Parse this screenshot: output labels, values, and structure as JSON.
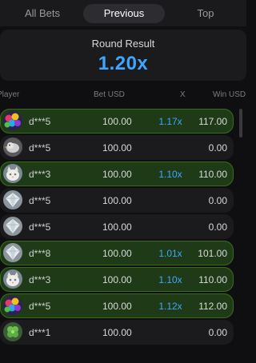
{
  "tabs": [
    {
      "label": "All Bets",
      "active": false
    },
    {
      "label": "Previous",
      "active": true
    },
    {
      "label": "Top",
      "active": false
    }
  ],
  "round": {
    "label": "Round Result",
    "value": "1.20x"
  },
  "columns": {
    "player": "Player",
    "bet": "Bet USD",
    "x": "X",
    "win": "Win USD"
  },
  "rows": [
    {
      "avatar": "balloons-avatar-icon",
      "name": "d***5",
      "bet": "100.00",
      "mult": "1.17x",
      "win": "117.00",
      "won": true
    },
    {
      "avatar": "bird-avatar-icon",
      "name": "d***5",
      "bet": "100.00",
      "mult": "",
      "win": "0.00",
      "won": false
    },
    {
      "avatar": "cat-avatar-icon",
      "name": "d***3",
      "bet": "100.00",
      "mult": "1.10x",
      "win": "110.00",
      "won": true
    },
    {
      "avatar": "diamond-avatar-icon",
      "name": "d***5",
      "bet": "100.00",
      "mult": "",
      "win": "0.00",
      "won": false
    },
    {
      "avatar": "diamond-avatar-icon",
      "name": "d***5",
      "bet": "100.00",
      "mult": "",
      "win": "0.00",
      "won": false
    },
    {
      "avatar": "diamond-avatar-icon",
      "name": "d***8",
      "bet": "100.00",
      "mult": "1.01x",
      "win": "101.00",
      "won": true
    },
    {
      "avatar": "cat-avatar-icon",
      "name": "d***3",
      "bet": "100.00",
      "mult": "1.10x",
      "win": "110.00",
      "won": true
    },
    {
      "avatar": "balloons-avatar-icon",
      "name": "d***5",
      "bet": "100.00",
      "mult": "1.12x",
      "win": "112.00",
      "won": true
    },
    {
      "avatar": "clover-avatar-icon",
      "name": "d***1",
      "bet": "100.00",
      "mult": "",
      "win": "0.00",
      "won": false
    }
  ],
  "colors": {
    "accent": "#3ea6ff",
    "win_row_bg": "#1f3a17",
    "row_bg": "#1b1b1e",
    "page_bg": "#0f0f11"
  }
}
